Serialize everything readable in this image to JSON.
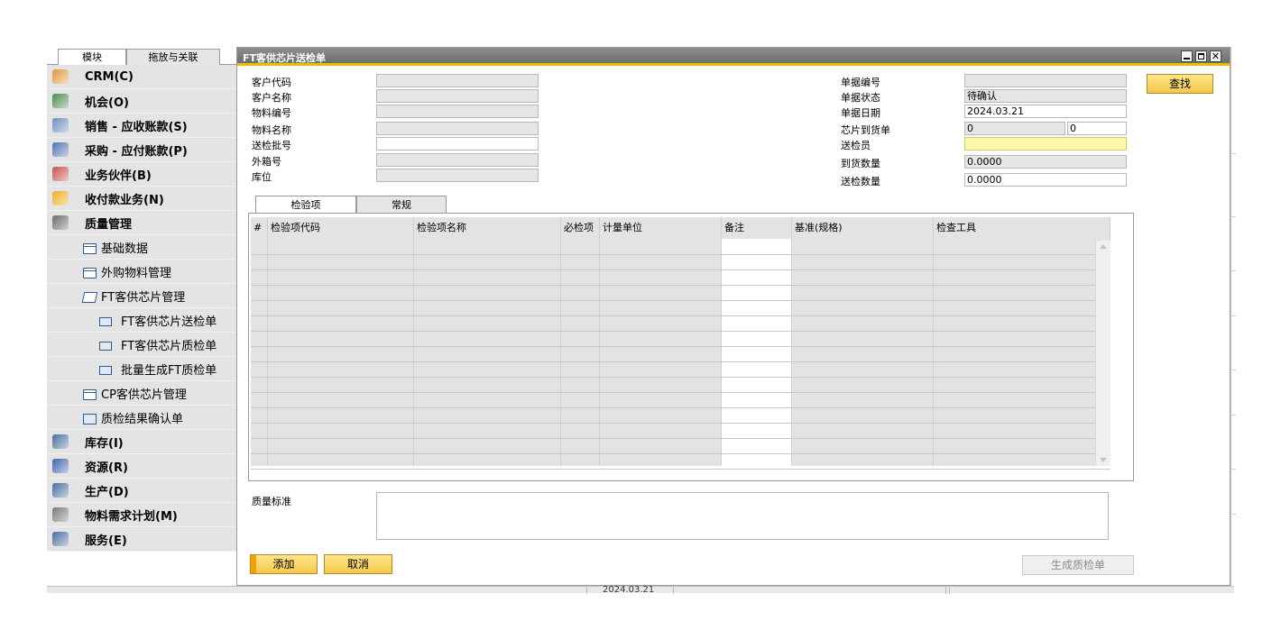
{
  "left_panel": {
    "tabs": [
      "模块",
      "拖放与关联"
    ],
    "menu": [
      {
        "label": "CRM(C)",
        "level": 0,
        "icon": "crm-icon"
      },
      {
        "label": "机会(O)",
        "level": 0,
        "icon": "opportunity-icon"
      },
      {
        "label": "销售 - 应收账款(S)",
        "level": 0,
        "icon": "sales-icon"
      },
      {
        "label": "采购 - 应付账款(P)",
        "level": 0,
        "icon": "purchase-cart-icon"
      },
      {
        "label": "业务伙伴(B)",
        "level": 0,
        "icon": "business-partner-icon"
      },
      {
        "label": "收付款业务(N)",
        "level": 0,
        "icon": "banking-icon"
      },
      {
        "label": "质量管理",
        "level": 0,
        "icon": "quality-management-icon"
      },
      {
        "label": "基础数据",
        "level": 1,
        "icon": "folder-icon"
      },
      {
        "label": "外购物料管理",
        "level": 1,
        "icon": "folder-icon"
      },
      {
        "label": "FT客供芯片管理",
        "level": 1,
        "icon": "folder-open-icon"
      },
      {
        "label": "FT客供芯片送检单",
        "level": 2,
        "icon": "document-icon"
      },
      {
        "label": "FT客供芯片质检单",
        "level": 2,
        "icon": "document-icon"
      },
      {
        "label": "批量生成FT质检单",
        "level": 2,
        "icon": "document-icon"
      },
      {
        "label": "CP客供芯片管理",
        "level": 1,
        "icon": "folder-icon"
      },
      {
        "label": "质检结果确认单",
        "level": 1,
        "icon": "document-icon"
      },
      {
        "label": "库存(I)",
        "level": 0,
        "icon": "inventory-icon"
      },
      {
        "label": "资源(R)",
        "level": 0,
        "icon": "resources-icon"
      },
      {
        "label": "生产(D)",
        "level": 0,
        "icon": "production-icon"
      },
      {
        "label": "物料需求计划(M)",
        "level": 0,
        "icon": "mrp-icon"
      },
      {
        "label": "服务(E)",
        "level": 0,
        "icon": "service-icon"
      }
    ]
  },
  "window": {
    "title": "FT客供芯片送检单",
    "left_fields": [
      {
        "label": "客户代码",
        "value": "",
        "style": "gray"
      },
      {
        "label": "客户名称",
        "value": "",
        "style": "gray"
      },
      {
        "label": "物料编号",
        "value": "",
        "style": "gray"
      },
      {
        "label": "物料名称",
        "value": "",
        "style": "gray"
      },
      {
        "label": "送检批号",
        "value": "",
        "style": "white"
      },
      {
        "label": "外箱号",
        "value": "",
        "style": "gray"
      },
      {
        "label": "库位",
        "value": "",
        "style": "gray"
      }
    ],
    "right_fields": [
      {
        "label": "单据编号",
        "value": ""
      },
      {
        "label": "单据状态",
        "value": "待确认"
      },
      {
        "label": "单据日期",
        "value": "2024.03.21"
      },
      {
        "label": "芯片到货单",
        "value": "0",
        "value2": "0"
      },
      {
        "label": "送检员",
        "value": ""
      },
      {
        "label": "到货数量",
        "value": "0.0000"
      },
      {
        "label": "送检数量",
        "value": "0.0000"
      }
    ],
    "find_button": "查找",
    "tabs": [
      "检验项",
      "常规"
    ],
    "grid_columns": [
      "#",
      "检验项代码",
      "检验项名称",
      "必检项",
      "计量单位",
      "备注",
      "基准(规格)",
      "检查工具"
    ],
    "quality_standard_label": "质量标准",
    "quality_standard_value": "",
    "buttons": {
      "add": "添加",
      "cancel": "取消",
      "generate": "生成质检单"
    }
  },
  "status_bar": {
    "date": "2024.03.21"
  },
  "colors": {
    "accent_yellow": "#f5c84a",
    "title_gray": "#7d7d7d",
    "title_underline": "#f5b800",
    "highlight_field": "#fff7a8"
  }
}
